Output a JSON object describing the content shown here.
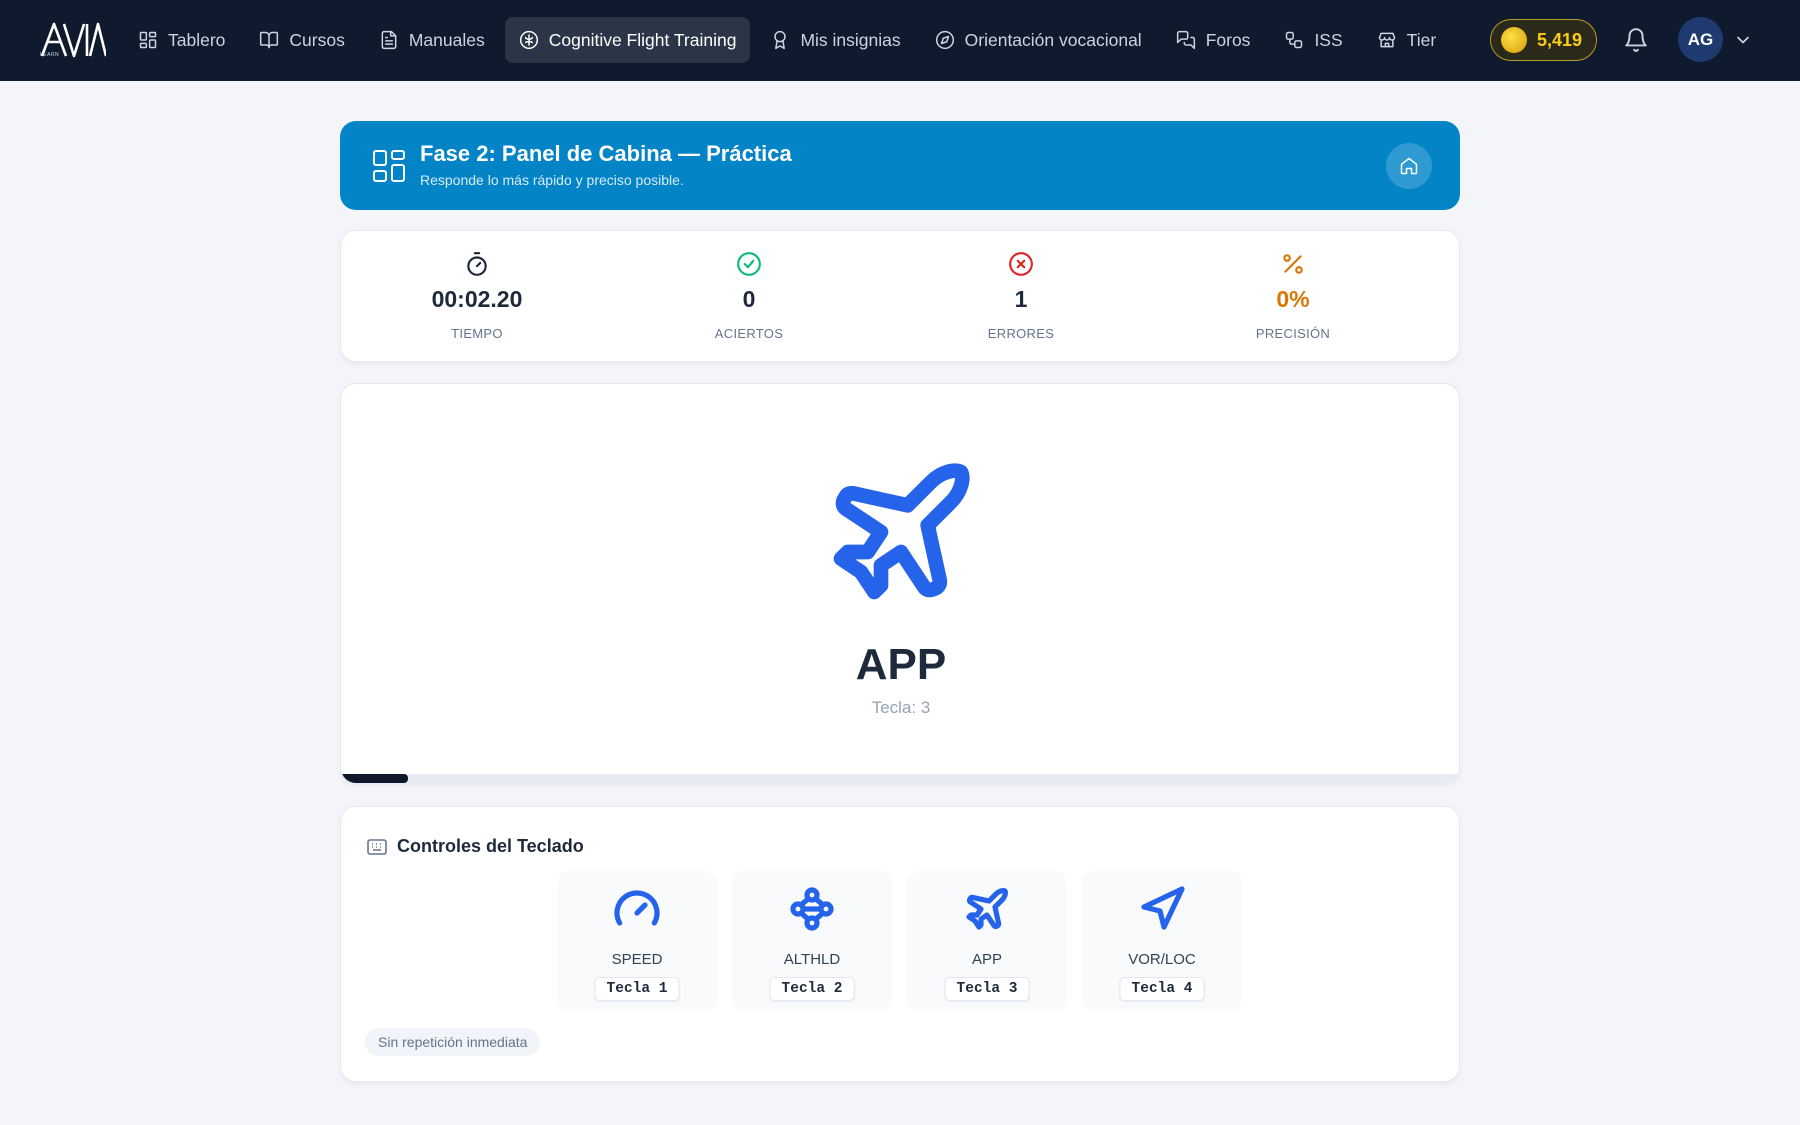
{
  "app": {
    "logo_text": "AVIA",
    "logo_sub": "LEARN"
  },
  "nav": {
    "items": [
      {
        "label": "Tablero",
        "icon": "dashboard-icon",
        "active": false
      },
      {
        "label": "Cursos",
        "icon": "book-icon",
        "active": false
      },
      {
        "label": "Manuales",
        "icon": "document-icon",
        "active": false
      },
      {
        "label": "Cognitive Flight Training",
        "icon": "brain-icon",
        "active": true
      },
      {
        "label": "Mis insignias",
        "icon": "badge-icon",
        "active": false
      },
      {
        "label": "Orientación vocacional",
        "icon": "compass-icon",
        "active": false
      },
      {
        "label": "Foros",
        "icon": "chat-icon",
        "active": false
      },
      {
        "label": "ISS",
        "icon": "network-icon",
        "active": false
      },
      {
        "label": "Tier",
        "icon": "store-icon",
        "active": false
      }
    ],
    "coins": "5,419",
    "avatar_initials": "AG"
  },
  "header": {
    "title": "Fase 2: Panel de Cabina — Práctica",
    "subtitle": "Responde lo más rápido y preciso posible."
  },
  "stats": [
    {
      "value": "00:02.20",
      "label": "TIEMPO",
      "icon": "stopwatch-icon",
      "color": "#1e293b"
    },
    {
      "value": "0",
      "label": "ACIERTOS",
      "icon": "check-circle-icon",
      "color": "#10b981"
    },
    {
      "value": "1",
      "label": "ERRORES",
      "icon": "x-circle-icon",
      "color": "#dc2626"
    },
    {
      "value": "0%",
      "label": "PRECISIÓN",
      "icon": "percent-icon",
      "color": "#d97706"
    }
  ],
  "stimulus": {
    "label": "APP",
    "hint": "Tecla: 3",
    "icon": "plane-icon",
    "progress": 0.06
  },
  "controls": {
    "title": "Controles del Teclado",
    "keys": [
      {
        "name": "SPEED",
        "key": "Tecla 1",
        "icon": "gauge-icon"
      },
      {
        "name": "ALTHLD",
        "key": "Tecla 2",
        "icon": "workflow-icon"
      },
      {
        "name": "APP",
        "key": "Tecla 3",
        "icon": "plane-icon"
      },
      {
        "name": "VOR/LOC",
        "key": "Tecla 4",
        "icon": "navigation-icon"
      }
    ],
    "tag": "Sin repetición inmediata"
  },
  "colors": {
    "nav_bg": "#0f1a2e",
    "banner": "#0284c7",
    "accent": "#2563eb",
    "coin": "#facc15"
  }
}
